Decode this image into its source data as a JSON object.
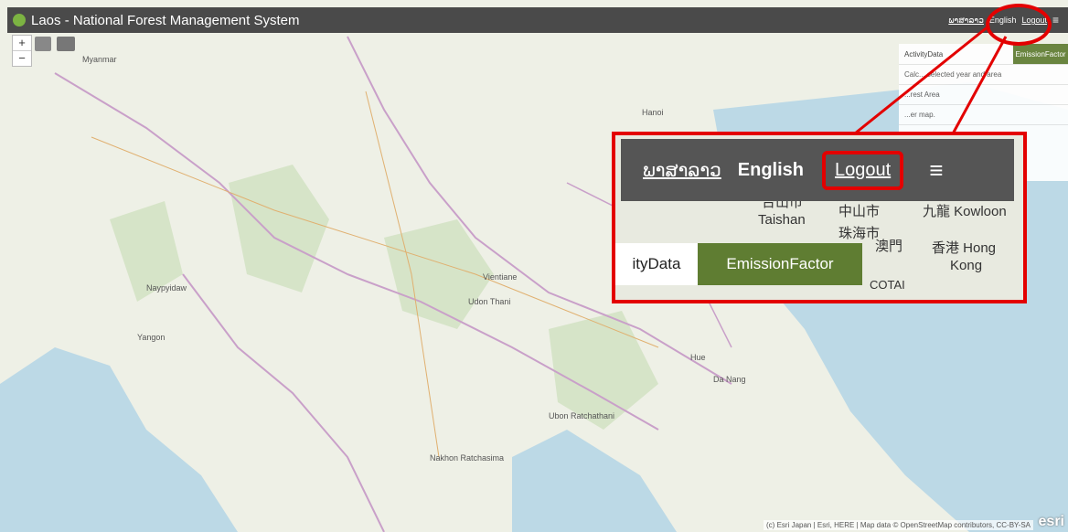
{
  "app": {
    "title": "Laos - National Forest Management System"
  },
  "topbar": {
    "lang_lao": "ພາສາລາວ",
    "lang_en": "English",
    "logout": "Logout",
    "menu_icon": "≡"
  },
  "map_controls": {
    "zoom_in": "+",
    "zoom_out": "−"
  },
  "side_panel": {
    "tab_activity": "ActivityData",
    "tab_emission": "EmissionFactor",
    "rows": [
      "Calc... selected year and area",
      "...rest Area",
      "...er map.",
      "...ge"
    ]
  },
  "zoom_callout": {
    "lang_lao": "ພາສາລາວ",
    "lang_en": "English",
    "logout": "Logout",
    "menu_icon": "≡",
    "tab_activity": "ityData",
    "tab_emission": "EmissionFactor",
    "places": [
      "台山市",
      "Taishan",
      "中山市",
      "珠海市",
      "九龍 Kowloon",
      "澳門",
      "香港 Hong",
      "Kong",
      "COTAI"
    ]
  },
  "map_places": [
    "Myanmar",
    "Hanoi",
    "Vientiane",
    "Udon Thani",
    "Naypyidaw",
    "Yangon",
    "Ubon Ratchathani",
    "Nakhon Ratchasima",
    "Da Nang",
    "Hue"
  ],
  "attribution": "(c) Esri Japan | Esri, HERE | Map data © OpenStreetMap contributors, CC-BY-SA",
  "esri_logo": "esri",
  "colors": {
    "topbar": "#4a4a4a",
    "accent_green": "#5f7d32",
    "highlight_red": "#e30000"
  }
}
